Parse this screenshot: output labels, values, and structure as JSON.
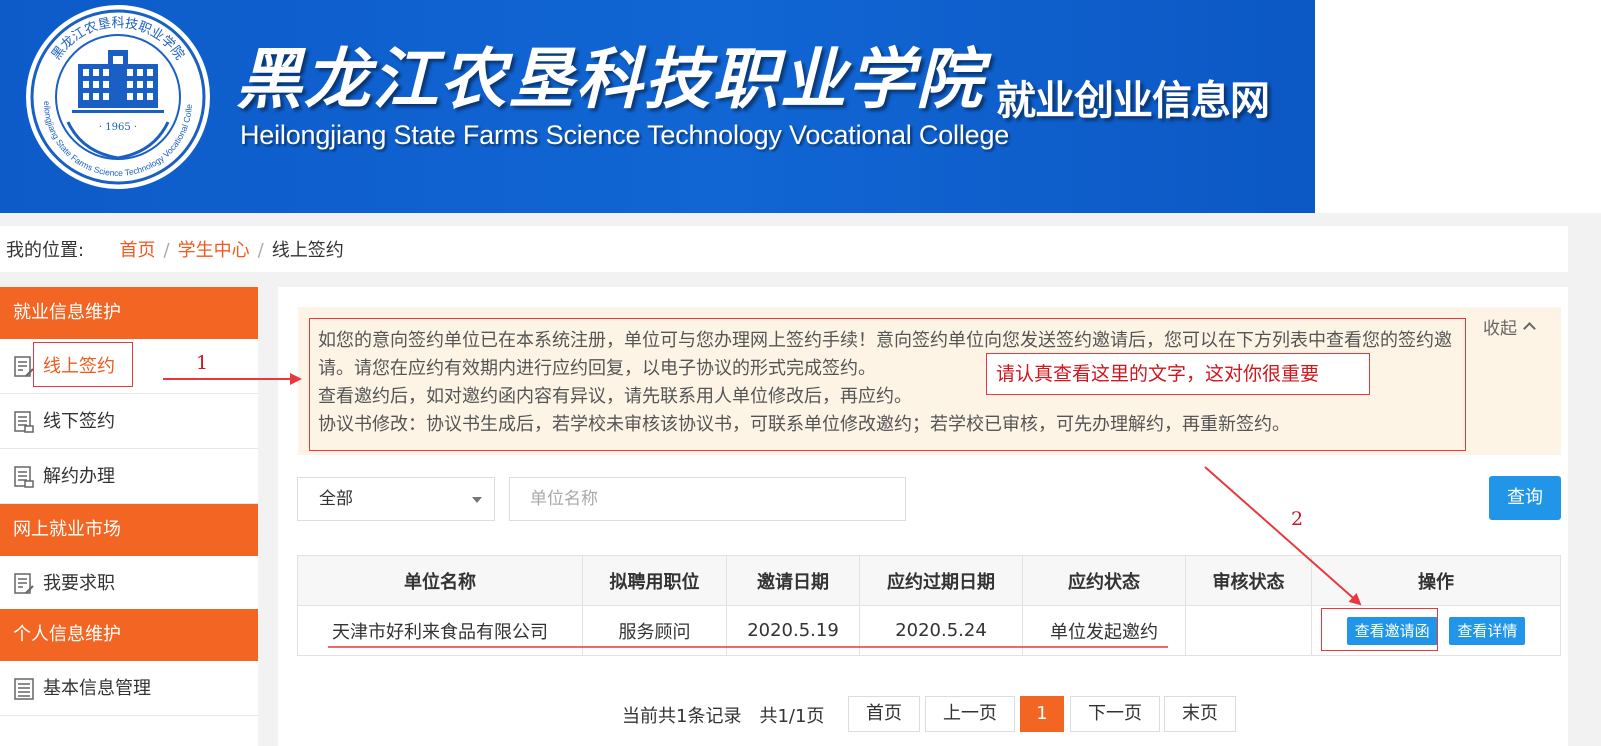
{
  "banner": {
    "cn_name": "黑龙江农垦科技职业学院",
    "en_name": "Heilongjiang State Farms Science Technology Vocational College",
    "sub_name": "就业创业信息网",
    "logo_year": "1965",
    "logo_ring_text": "黑龙江农垦科技职业学院",
    "logo_ring_en": "Heilongjiang State Farms Science Technology Vocational College",
    "brand_color": "#0f60cc"
  },
  "breadcrumb": {
    "label": "我的位置:",
    "items": [
      "首页",
      "学生中心",
      "线上签约"
    ],
    "link_color": "#f05a1e"
  },
  "sidebar": {
    "accent": "#f26522",
    "sections": [
      {
        "title": "就业信息维护",
        "items": [
          {
            "label": "线上签约",
            "icon": "document-edit-icon",
            "active": true
          },
          {
            "label": "线下签约",
            "icon": "document-icon"
          },
          {
            "label": "解约办理",
            "icon": "document-icon"
          }
        ]
      },
      {
        "title": "网上就业市场",
        "items": [
          {
            "label": "我要求职",
            "icon": "document-edit-icon"
          }
        ]
      },
      {
        "title": "个人信息维护",
        "items": [
          {
            "label": "基本信息管理",
            "icon": "list-icon"
          }
        ]
      }
    ]
  },
  "notice": {
    "lines": [
      "如您的意向签约单位已在本系统注册，单位可与您办理网上签约手续！意向签约单位向您发送签约邀请后，您可以在下方列表中查看您的签约邀请。请您在应约有效期内进行应约回复，以电子协议的形式完成签约。",
      "查看邀约后，如对邀约函内容有异议，请先联系用人单位修改后，再应约。",
      "协议书修改：协议书生成后，若学校未审核该协议书，可联系单位修改邀约；若学校已审核，可先办理解约，再重新签约。"
    ],
    "collapse_label": "收起"
  },
  "filter": {
    "select_value": "全部",
    "input_placeholder": "单位名称",
    "query_label": "查询"
  },
  "table": {
    "headers": [
      "单位名称",
      "拟聘用职位",
      "邀请日期",
      "应约过期日期",
      "应约状态",
      "审核状态",
      "操作"
    ],
    "rows": [
      {
        "company": "天津市好利来食品有限公司",
        "position": "服务顾问",
        "invite_date": "2020.5.19",
        "expire_date": "2020.5.24",
        "status": "单位发起邀约",
        "review": "",
        "actions": [
          "查看邀请函",
          "查看详情"
        ]
      }
    ]
  },
  "pager": {
    "info": "当前共1条记录　共1/1页",
    "first": "首页",
    "prev": "上一页",
    "current": "1",
    "next": "下一页",
    "last": "末页"
  },
  "annotations": {
    "callout": "请认真查看这里的文字，这对你很重要",
    "num1": "1",
    "num2": "2",
    "color": "#e8383d"
  }
}
